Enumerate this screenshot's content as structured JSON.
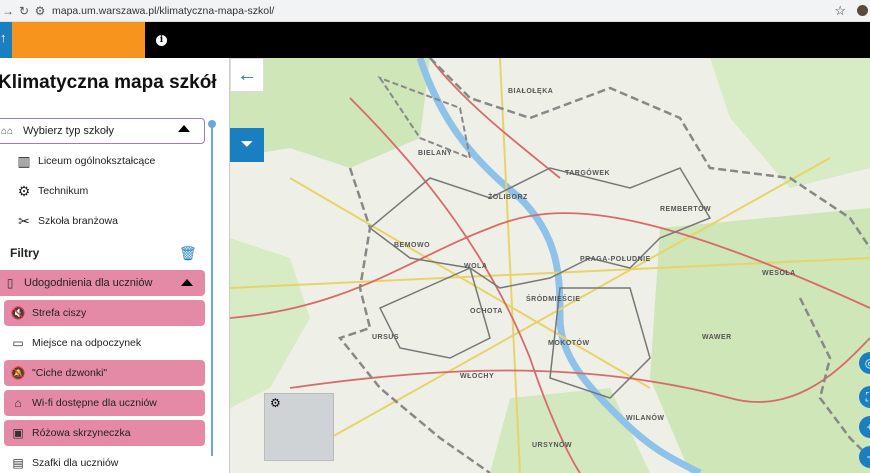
{
  "browser": {
    "url": "mapa.um.warszawa.pl/klimatyczna-mapa-szkol/"
  },
  "app": {
    "title": "Klimatyczna mapa szkół"
  },
  "school_type": {
    "label": "Wybierz typ szkoły",
    "options": [
      "Liceum ogólnokształcące",
      "Technikum",
      "Szkoła branżowa"
    ]
  },
  "filters": {
    "heading": "Filtry",
    "group": "Udogodnienia dla uczniów",
    "items": [
      {
        "label": "Strefa ciszy",
        "active": true
      },
      {
        "label": "Miejsce na odpoczynek",
        "active": false
      },
      {
        "label": "\"Ciche dzwonki\"",
        "active": true
      },
      {
        "label": "Wi-fi dostępne dla uczniów",
        "active": true
      },
      {
        "label": "Różowa skrzyneczka",
        "active": true
      },
      {
        "label": "Szafki dla uczniów",
        "active": false
      }
    ]
  },
  "map": {
    "districts": [
      "BIAŁOŁĘKA",
      "BIELANY",
      "TARGÓWEK",
      "ŻOLIBORZ",
      "REMBERTÓW",
      "BEMOWO",
      "PRAGA-POŁUDNIE",
      "WOLA",
      "ŚRÓDMIEŚCIE",
      "WESOŁA",
      "OCHOTA",
      "URSUS",
      "MOKOTÓW",
      "WAWER",
      "WŁOCHY",
      "WILANÓW",
      "URSYNÓW"
    ]
  },
  "colors": {
    "accent": "#1a7fc1",
    "pink": "#e58aa6",
    "orange": "#f7941d"
  }
}
